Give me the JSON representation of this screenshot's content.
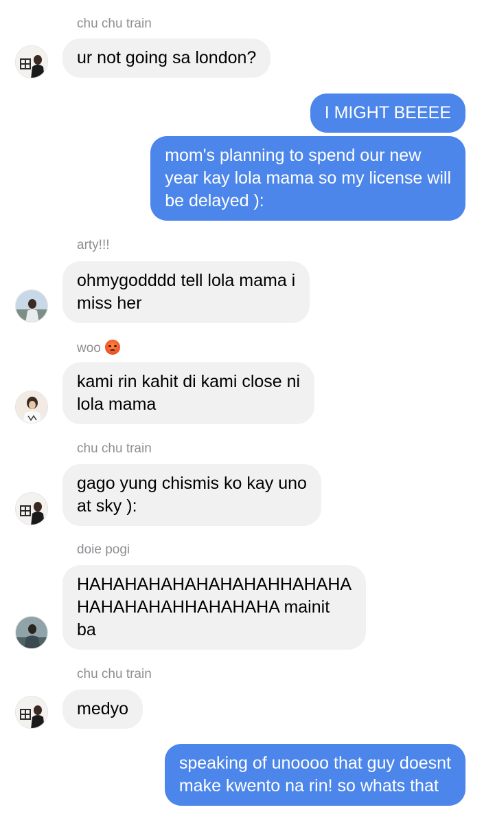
{
  "colors": {
    "incoming_bubble": "#f1f1f2",
    "outgoing_bubble": "#4c86eb",
    "sender_label": "#8e8e93"
  },
  "messages": [
    {
      "kind": "incoming",
      "sender": "chu chu train",
      "avatar": "chu-chu-train-avatar",
      "lines": [
        "ur not going sa london?"
      ]
    },
    {
      "kind": "outgoing",
      "lines": [
        "I MIGHT BEEEE"
      ]
    },
    {
      "kind": "outgoing",
      "lines": [
        "mom's planning to spend our new",
        "year kay lola mama so my license will",
        "be delayed ):"
      ]
    },
    {
      "kind": "incoming",
      "sender": "arty!!!",
      "avatar": "arty-avatar",
      "lines": [
        "ohmygodddd tell lola mama i",
        "miss her"
      ]
    },
    {
      "kind": "incoming",
      "sender": "woo",
      "sender_emoji": "pouting-face-emoji",
      "avatar": "woo-avatar",
      "lines": [
        "kami rin kahit di kami close ni",
        "lola mama"
      ]
    },
    {
      "kind": "incoming",
      "sender": "chu chu train",
      "avatar": "chu-chu-train-avatar",
      "lines": [
        "gago yung chismis ko kay uno",
        "at sky ):"
      ]
    },
    {
      "kind": "incoming",
      "sender": "doie pogi",
      "avatar": "doie-pogi-avatar",
      "lines": [
        "HAHAHAHAHAHAHAHAHHAHAHA",
        "HAHAHAHAHHAHAHAHA mainit",
        "ba"
      ]
    },
    {
      "kind": "incoming",
      "sender": "chu chu train",
      "avatar": "chu-chu-train-avatar",
      "lines": [
        "medyo"
      ]
    },
    {
      "kind": "outgoing",
      "lines": [
        "speaking of unoooo that guy doesnt",
        "make kwento na rin! so whats that"
      ]
    }
  ]
}
